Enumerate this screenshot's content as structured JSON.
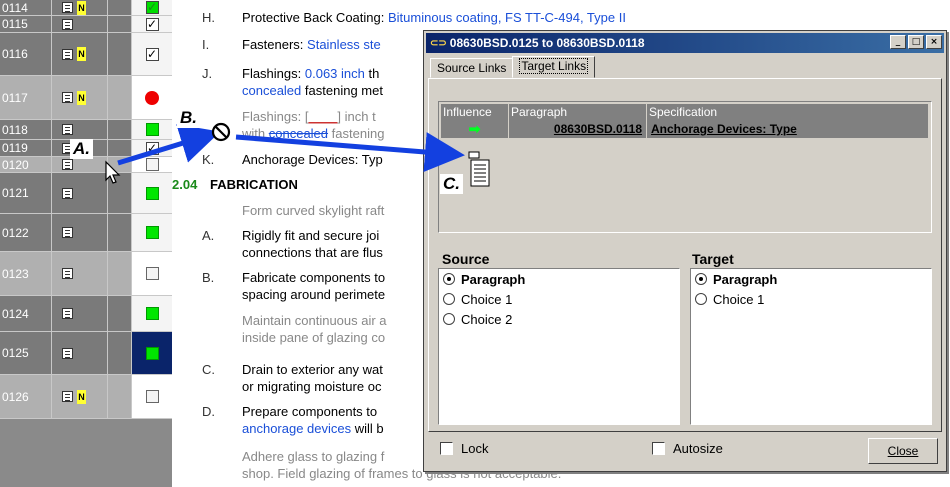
{
  "grid": {
    "rows": [
      {
        "num": "0114",
        "n": true,
        "status": "check-green",
        "shade": "dark"
      },
      {
        "num": "0115",
        "n": false,
        "status": "check",
        "shade": "dark"
      },
      {
        "num": "0116",
        "n": true,
        "status": "check",
        "shade": "dark"
      },
      {
        "num": "0117",
        "n": true,
        "status": "red-dot",
        "shade": "light"
      },
      {
        "num": "0118",
        "n": false,
        "status": "green",
        "shade": "dark"
      },
      {
        "num": "0119",
        "n": true,
        "status": "check",
        "shade": "dark"
      },
      {
        "num": "0120",
        "n": false,
        "status": "empty",
        "shade": "light"
      },
      {
        "num": "0121",
        "n": false,
        "status": "green",
        "shade": "dark"
      },
      {
        "num": "0122",
        "n": false,
        "status": "green",
        "shade": "dark"
      },
      {
        "num": "0123",
        "n": false,
        "status": "empty",
        "shade": "light"
      },
      {
        "num": "0124",
        "n": false,
        "status": "green",
        "shade": "dark"
      },
      {
        "num": "0125",
        "n": false,
        "status": "green-selected",
        "shade": "dark"
      },
      {
        "num": "0126",
        "n": true,
        "status": "empty",
        "shade": "light"
      }
    ],
    "n_label": "N",
    "check_glyph": "✓"
  },
  "doc": {
    "h_letter": "H.",
    "h_label": "Protective Back Coating:",
    "h_value": "Bituminous coating, FS TT-C-494, Type II",
    "i_letter": "I.",
    "i_label": "Fasteners:",
    "i_value": "Stainless ste",
    "j_letter": "J.",
    "j_label": "Flashings:",
    "j_value": "0.063 inch",
    "j_rest": "th",
    "j2_blue": "concealed",
    "j2_rest": "fastening met",
    "k0_label": "Flashings: [",
    "k0_blank": "____",
    "k0_rest": "] inch t",
    "k0b_pre": "with",
    "k0b_blue": "concealed",
    "k0b_rest": "fastening",
    "k_letter": "K.",
    "k_text": "Anchorage Devices: Typ",
    "fab_num": "2.04",
    "fab_title": "FABRICATION",
    "fab_gray": "Form curved skylight raft",
    "a_letter": "A.",
    "a_text1": "Rigidly fit and secure joi",
    "a_text2": "connections that are flus",
    "b_letter": "B.",
    "b_text1": "Fabricate components to",
    "b_text2": "spacing around perimete",
    "b_gray1": "Maintain continuous air a",
    "b_gray2": "inside pane of glazing co",
    "c_letter": "C.",
    "c_text1": "Drain to exterior any wat",
    "c_text2": "or migrating moisture oc",
    "d_letter": "D.",
    "d_text1": "Prepare components to",
    "d_blue": "anchorage devices",
    "d_rest": "will b",
    "e_gray1": "Adhere glass to glazing f",
    "e_gray2": "shop.  Field glazing of frames to glass is not acceptable."
  },
  "dialog": {
    "title": "08630BSD.0125 to 08630BSD.0118",
    "min": "_",
    "max": "□",
    "close_x": "×",
    "tabs": [
      "Source Links",
      "Target Links"
    ],
    "active_tab": "Target Links",
    "columns": [
      "Influence",
      "Paragraph",
      "Specification"
    ],
    "link_row": {
      "influence": "➡",
      "paragraph": "08630BSD.0118",
      "specification": "Anchorage Devices:  Type"
    },
    "source_label": "Source",
    "target_label": "Target",
    "source_options": [
      {
        "label": "Paragraph",
        "selected": true
      },
      {
        "label": "Choice 1",
        "selected": false
      },
      {
        "label": "Choice 2",
        "selected": false
      }
    ],
    "target_options": [
      {
        "label": "Paragraph",
        "selected": true
      },
      {
        "label": "Choice 1",
        "selected": false
      }
    ],
    "lock_label": "Lock",
    "autosize_label": "Autosize",
    "close_label": "Close"
  },
  "callouts": {
    "a": "A.",
    "b": "B.",
    "c": "C."
  },
  "colors": {
    "arrow": "#1340e0",
    "selection": "#0a246a",
    "link_blue": "#1a4fd8",
    "heading_green": "#1a8a1a"
  }
}
